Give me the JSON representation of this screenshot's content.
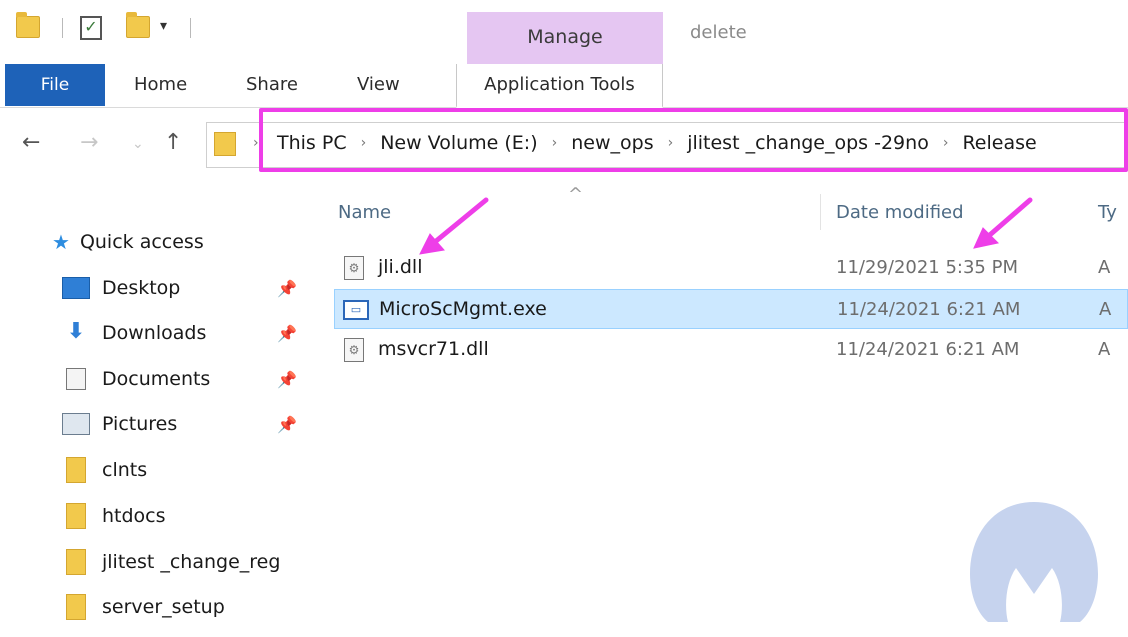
{
  "title_bar": {
    "manage_tab": "Manage",
    "window_title": "delete"
  },
  "ribbon": {
    "file": "File",
    "home": "Home",
    "share": "Share",
    "view": "View",
    "app_tools": "Application Tools"
  },
  "address": {
    "crumbs": [
      "This PC",
      "New Volume (E:)",
      "new_ops",
      "jlitest _change_ops -29no",
      "Release"
    ]
  },
  "sidebar": {
    "quick_access": "Quick access",
    "items": [
      {
        "label": "Desktop",
        "icon": "desktop-icon",
        "pinned": true
      },
      {
        "label": "Downloads",
        "icon": "download-icon",
        "pinned": true
      },
      {
        "label": "Documents",
        "icon": "documents-icon",
        "pinned": true
      },
      {
        "label": "Pictures",
        "icon": "pictures-icon",
        "pinned": true
      },
      {
        "label": "clnts",
        "icon": "folder-icon",
        "pinned": false
      },
      {
        "label": "htdocs",
        "icon": "folder-icon",
        "pinned": false
      },
      {
        "label": "jlitest _change_reg",
        "icon": "folder-icon",
        "pinned": false
      },
      {
        "label": "server_setup",
        "icon": "folder-icon",
        "pinned": false
      }
    ]
  },
  "file_list": {
    "columns": {
      "name": "Name",
      "date": "Date modified",
      "type": "Ty"
    },
    "rows": [
      {
        "name": "jli.dll",
        "date": "11/29/2021 5:35 PM",
        "type": "A",
        "icon": "dll-file-icon",
        "selected": false
      },
      {
        "name": "MicroScMgmt.exe",
        "date": "11/24/2021 6:21 AM",
        "type": "A",
        "icon": "exe-file-icon",
        "selected": true
      },
      {
        "name": "msvcr71.dll",
        "date": "11/24/2021 6:21 AM",
        "type": "A",
        "icon": "dll-file-icon",
        "selected": false
      }
    ]
  },
  "colors": {
    "file_tab": "#1e62b8",
    "manage_tab": "#e5c6f2",
    "highlight": "#ee3ee8",
    "selected_row": "#cce8ff",
    "watermark": "#c6d3ee"
  }
}
